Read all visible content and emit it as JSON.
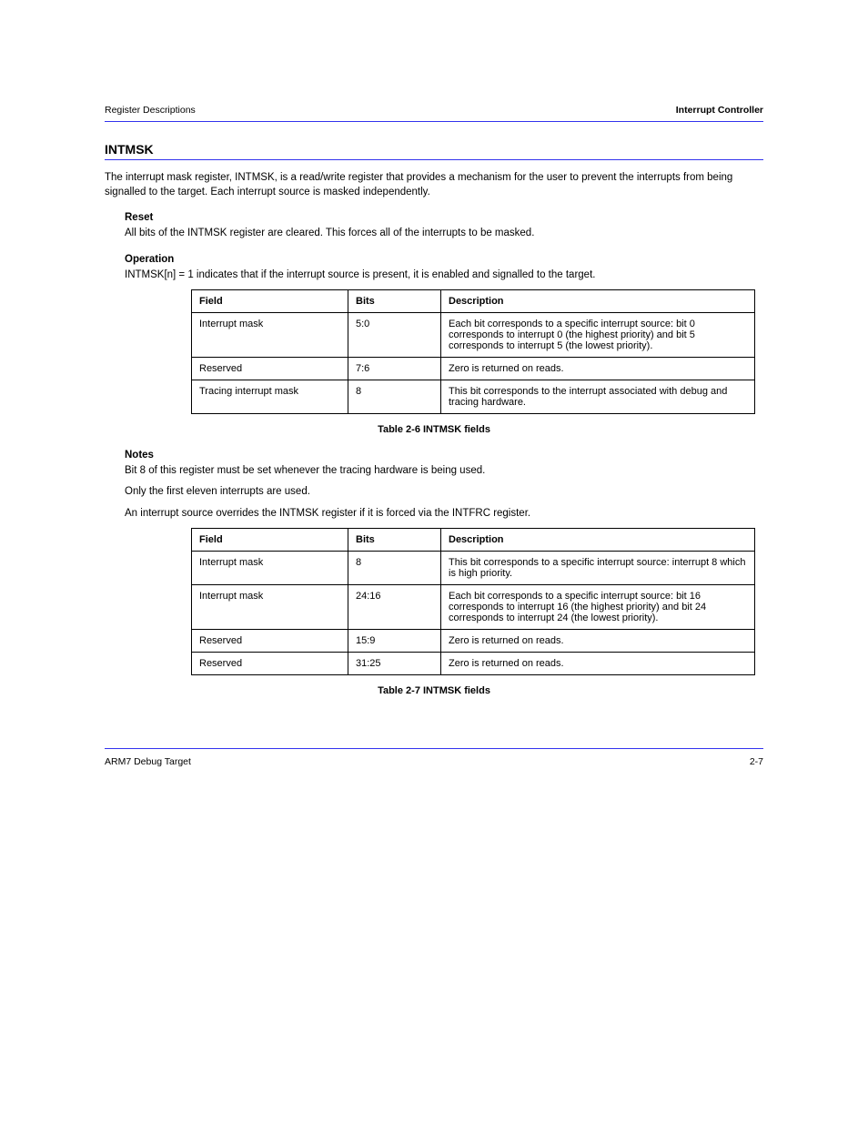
{
  "header": {
    "left": "Register Descriptions",
    "right": "Interrupt Controller"
  },
  "section_heading": "INTMSK",
  "intro": "The interrupt mask register, INTMSK, is a read/write register that provides a mechanism for the user to prevent the interrupts from being signalled to the target. Each interrupt source is masked independently.",
  "reset": {
    "label": "Reset",
    "text": "All bits of the INTMSK register are cleared. This forces all of the interrupts to be masked."
  },
  "operation": {
    "label": "Operation",
    "text": "INTMSK[n] = 1 indicates that if the interrupt source is present, it is enabled and signalled to the target."
  },
  "table1": {
    "headers": [
      "Field",
      "Bits",
      "Description"
    ],
    "rows": [
      {
        "field": "Interrupt mask",
        "bits": "5:0",
        "desc": "Each bit corresponds to a specific interrupt source: bit 0 corresponds to interrupt 0 (the highest priority) and bit 5 corresponds to interrupt 5 (the lowest priority)."
      },
      {
        "field": "Reserved",
        "bits": "7:6",
        "desc": "Zero is returned on reads."
      },
      {
        "field": "Tracing interrupt mask",
        "bits": "8",
        "desc": "This bit corresponds to the interrupt associated with debug and tracing hardware."
      }
    ]
  },
  "table1_caption": "Table 2-6 INTMSK fields",
  "notes_label": "Notes",
  "notes": [
    "Bit 8 of this register must be set whenever the tracing hardware is being used.",
    "Only the first eleven interrupts are used.",
    "An interrupt source overrides the INTMSK register if it is forced via the INTFRC register."
  ],
  "table2": {
    "headers": [
      "Field",
      "Bits",
      "Description"
    ],
    "rows": [
      {
        "field": "Interrupt mask",
        "bits": "8",
        "desc": "This bit corresponds to a specific interrupt source: interrupt 8 which is high priority."
      },
      {
        "field": "Interrupt mask",
        "bits": "24:16",
        "desc": "Each bit corresponds to a specific interrupt source: bit 16 corresponds to interrupt 16 (the highest priority) and bit 24 corresponds to interrupt 24 (the lowest priority)."
      },
      {
        "field": "Reserved",
        "bits": "15:9",
        "desc": "Zero is returned on reads."
      },
      {
        "field": "Reserved",
        "bits": "31:25",
        "desc": "Zero is returned on reads."
      }
    ]
  },
  "table2_caption": "Table 2-7 INTMSK fields",
  "footer": {
    "left": "ARM7 Debug Target",
    "right": "2-7"
  }
}
